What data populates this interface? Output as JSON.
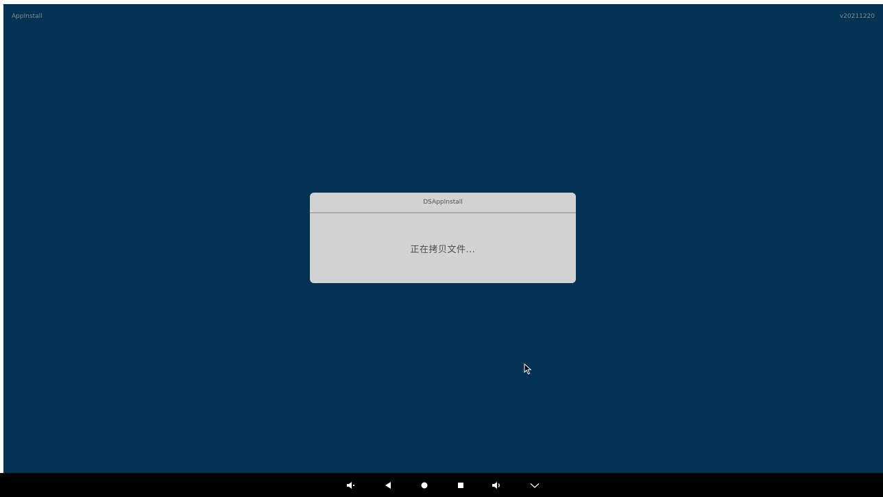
{
  "app": {
    "name": "AppInstall",
    "version": "v20211220",
    "background": "#023352"
  },
  "dialog": {
    "title": "DSAppInstall",
    "message": "正在拷贝文件..."
  },
  "nav_bar": {
    "buttons": [
      {
        "name": "volume-down-icon"
      },
      {
        "name": "back-icon"
      },
      {
        "name": "home-icon"
      },
      {
        "name": "recents-icon"
      },
      {
        "name": "volume-up-icon"
      },
      {
        "name": "chevron-down-icon"
      }
    ]
  }
}
